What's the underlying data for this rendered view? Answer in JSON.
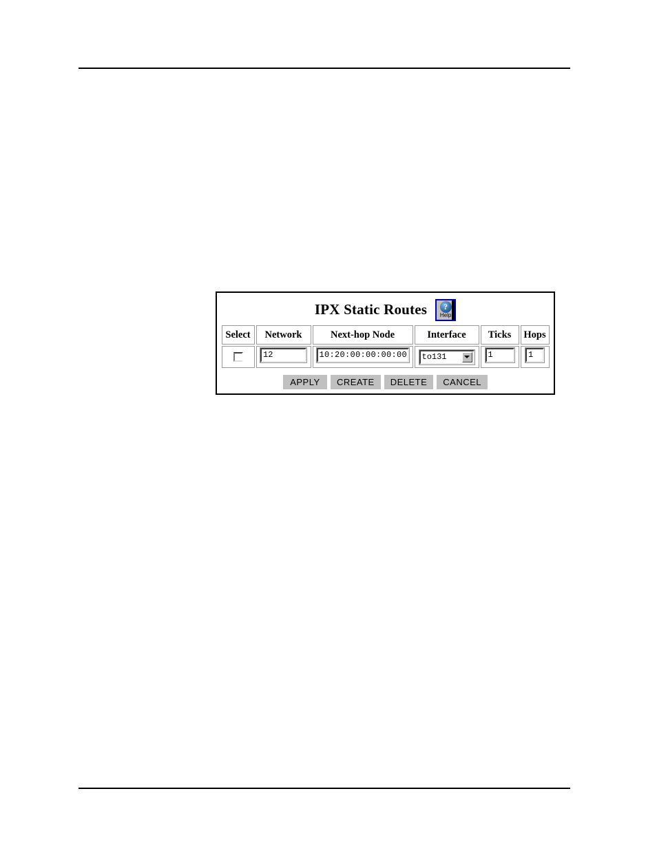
{
  "page": {
    "top_rule": "",
    "bottom_rule": ""
  },
  "panel": {
    "title": "IPX Static Routes",
    "help_icon": {
      "name": "help-icon",
      "glyph": "?",
      "label": "Help",
      "border_color": "#0000b4",
      "face_color": "#c0c0c0"
    }
  },
  "table": {
    "columns": [
      {
        "key": "select",
        "label": "Select"
      },
      {
        "key": "network",
        "label": "Network"
      },
      {
        "key": "nexthop",
        "label": "Next-hop Node"
      },
      {
        "key": "interface",
        "label": "Interface"
      },
      {
        "key": "ticks",
        "label": "Ticks"
      },
      {
        "key": "hops",
        "label": "Hops"
      }
    ],
    "rows": [
      {
        "select": {
          "checked": false
        },
        "network": {
          "value": "12",
          "placeholder": ""
        },
        "nexthop": {
          "value": "10:20:00:00:00:00",
          "placeholder": ""
        },
        "interface": {
          "value": "to131",
          "options": [
            "to131"
          ]
        },
        "ticks": {
          "value": "1",
          "placeholder": ""
        },
        "hops": {
          "value": "1",
          "placeholder": ""
        }
      }
    ]
  },
  "buttons": [
    {
      "key": "apply",
      "label": "APPLY"
    },
    {
      "key": "create",
      "label": "CREATE"
    },
    {
      "key": "delete",
      "label": "DELETE"
    },
    {
      "key": "cancel",
      "label": "CANCEL"
    }
  ],
  "colors": {
    "button_face": "#c0c0c0",
    "panel_border": "#000000",
    "cell_border": "#9a9a9a",
    "help_border": "#0000b4"
  }
}
